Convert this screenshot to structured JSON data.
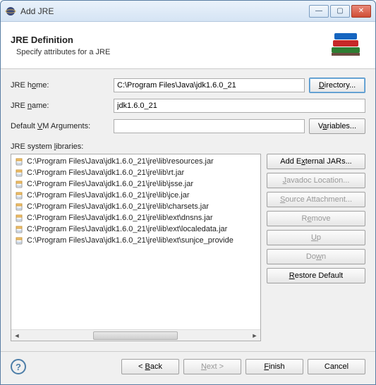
{
  "window": {
    "title": "Add JRE"
  },
  "header": {
    "title": "JRE Definition",
    "subtitle": "Specify attributes for a JRE"
  },
  "form": {
    "jre_home": {
      "label": "JRE home:",
      "value": "C:\\Program Files\\Java\\jdk1.6.0_21",
      "button": "Directory..."
    },
    "jre_name": {
      "label": "JRE name:",
      "value": "jdk1.6.0_21"
    },
    "vm_args": {
      "label": "Default VM Arguments:",
      "value": "",
      "button": "Variables..."
    },
    "libs_label": "JRE system libraries:"
  },
  "libs": [
    "C:\\Program Files\\Java\\jdk1.6.0_21\\jre\\lib\\resources.jar",
    "C:\\Program Files\\Java\\jdk1.6.0_21\\jre\\lib\\rt.jar",
    "C:\\Program Files\\Java\\jdk1.6.0_21\\jre\\lib\\jsse.jar",
    "C:\\Program Files\\Java\\jdk1.6.0_21\\jre\\lib\\jce.jar",
    "C:\\Program Files\\Java\\jdk1.6.0_21\\jre\\lib\\charsets.jar",
    "C:\\Program Files\\Java\\jdk1.6.0_21\\jre\\lib\\ext\\dnsns.jar",
    "C:\\Program Files\\Java\\jdk1.6.0_21\\jre\\lib\\ext\\localedata.jar",
    "C:\\Program Files\\Java\\jdk1.6.0_21\\jre\\lib\\ext\\sunjce_provide"
  ],
  "side_buttons": {
    "add_external": "Add External JARs...",
    "javadoc": "Javadoc Location...",
    "source": "Source Attachment...",
    "remove": "Remove",
    "up": "Up",
    "down": "Down",
    "restore": "Restore Default"
  },
  "footer": {
    "back": "< Back",
    "next": "Next >",
    "finish": "Finish",
    "cancel": "Cancel"
  }
}
